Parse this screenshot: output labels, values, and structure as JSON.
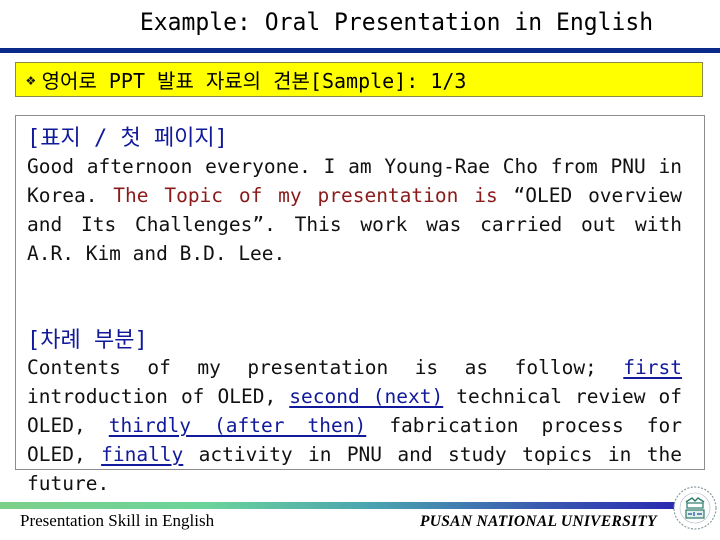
{
  "slide": {
    "title": "Example: Oral Presentation in English",
    "subtitle": {
      "bullet_icon": "diamond-bullet-icon",
      "bullet_glyph": "❖",
      "text": "영어로 PPT 발표 자료의 견본[Sample]: 1/3"
    },
    "section1": {
      "heading": "[표지 / 첫 페이지]",
      "lines": [
        {
          "parts": [
            {
              "text": "Good afternoon everyone. I am Young-Rae Cho from PNU in",
              "style": "normal"
            }
          ]
        },
        {
          "parts": [
            {
              "text": "Korea. ",
              "style": "normal"
            },
            {
              "text": "The Topic of my presentation is",
              "style": "red"
            },
            {
              "text": " “OLED overview",
              "style": "normal"
            }
          ]
        },
        {
          "parts": [
            {
              "text": "and Its Challenges”. This work was carried out with",
              "style": "normal"
            }
          ]
        },
        {
          "parts": [
            {
              "text": "A.R. Kim and B.D. Lee.",
              "style": "normal"
            }
          ]
        }
      ]
    },
    "section2": {
      "heading": "[차례 부분]",
      "lines": [
        {
          "parts": [
            {
              "text": "Contents of my presentation is as follow; ",
              "style": "normal"
            },
            {
              "text": "first",
              "style": "underline"
            }
          ]
        },
        {
          "parts": [
            {
              "text": "introduction of OLED, ",
              "style": "normal"
            },
            {
              "text": "second (next)",
              "style": "underline"
            },
            {
              "text": " technical review of",
              "style": "normal"
            }
          ]
        },
        {
          "parts": [
            {
              "text": "OLED, ",
              "style": "normal"
            },
            {
              "text": "thirdly (after then)",
              "style": "underline"
            },
            {
              "text": " fabrication process for",
              "style": "normal"
            }
          ]
        },
        {
          "parts": [
            {
              "text": "OLED, ",
              "style": "normal"
            },
            {
              "text": "finally",
              "style": "underline"
            },
            {
              "text": " activity in PNU and study topics in the",
              "style": "normal"
            }
          ]
        },
        {
          "parts": [
            {
              "text": "future.",
              "style": "normal"
            }
          ]
        }
      ]
    },
    "footer": {
      "left": "Presentation Skill in English",
      "right": "PUSAN NATIONAL UNIVERSITY",
      "logo_icon": "university-seal-icon"
    }
  },
  "colors": {
    "title_rule": "#0a2a8a",
    "subtitle_bg": "#ffff00",
    "heading": "#101a9a",
    "highlight_red": "#8b1a1a",
    "underline_blue": "#101a9a"
  }
}
